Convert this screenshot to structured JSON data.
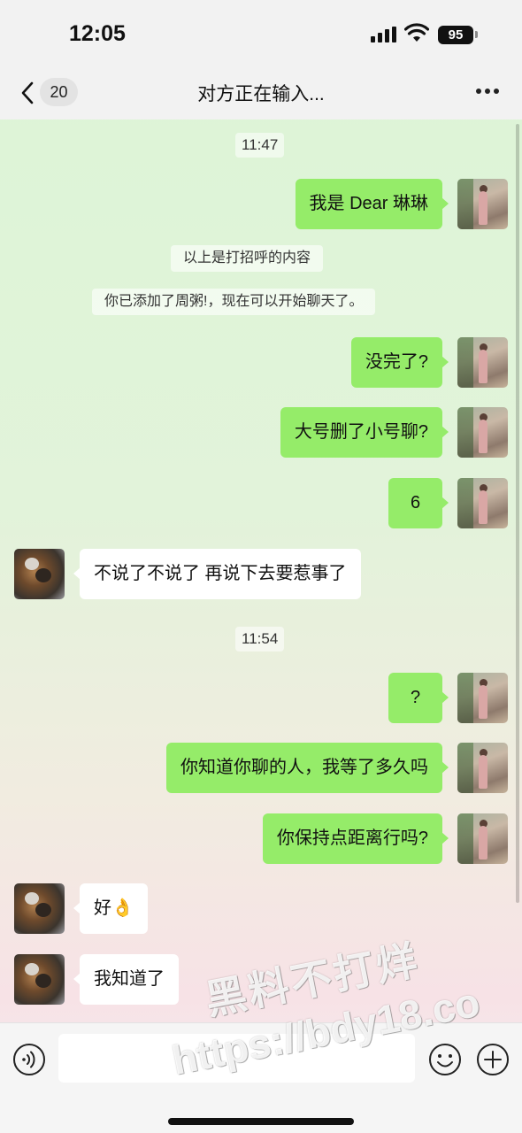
{
  "status_bar": {
    "time": "12:05",
    "battery": "95"
  },
  "nav": {
    "back_count": "20",
    "title": "对方正在输入..."
  },
  "messages": [
    {
      "kind": "time",
      "text": "11:47"
    },
    {
      "kind": "out",
      "text": "我是 Dear 琳琳"
    },
    {
      "kind": "system",
      "text": "以上是打招呼的内容"
    },
    {
      "kind": "system",
      "text": "你已添加了周粥!，现在可以开始聊天了。"
    },
    {
      "kind": "out",
      "text": "没完了?"
    },
    {
      "kind": "out",
      "text": "大号删了小号聊?"
    },
    {
      "kind": "out",
      "text": "6"
    },
    {
      "kind": "in",
      "text": "不说了不说了 再说下去要惹事了"
    },
    {
      "kind": "time",
      "text": "11:54"
    },
    {
      "kind": "out",
      "text": "?"
    },
    {
      "kind": "out",
      "text": "你知道你聊的人，我等了多久吗"
    },
    {
      "kind": "out",
      "text": "你保持点距离行吗?"
    },
    {
      "kind": "in",
      "text": "好👌"
    },
    {
      "kind": "in",
      "text": "我知道了"
    }
  ],
  "input_bar": {
    "placeholder": ""
  },
  "watermark": {
    "line1": "黑料不打烊",
    "line2": "https://bdy18.co"
  },
  "colors": {
    "outgoing_bubble": "#95ec69",
    "incoming_bubble": "#ffffff"
  },
  "icons": [
    "back-chevron-icon",
    "more-icon",
    "voice-icon",
    "emoji-icon",
    "plus-icon",
    "signal-icon",
    "wifi-icon",
    "battery-icon"
  ]
}
